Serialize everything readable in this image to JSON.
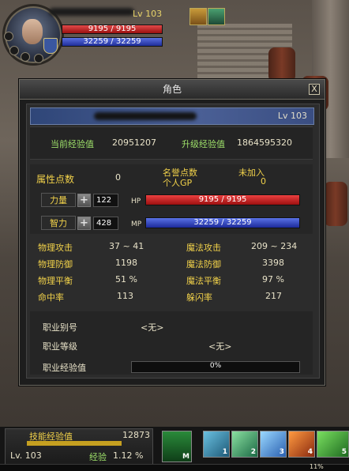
{
  "top": {
    "level": "Lv 103",
    "hp": "9195 / 9195",
    "mp": "32259 / 32259"
  },
  "window": {
    "title": "角色",
    "close": "X",
    "name_level": "Lv 103",
    "exp": {
      "current_label": "当前经验值",
      "current_value": "20951207",
      "next_label": "升级经验值",
      "next_value": "1864595320"
    },
    "attr": {
      "points_label": "属性点数",
      "points_value": "0",
      "fame_label": "名誉点数",
      "fame_value": "未加入",
      "gp_label": "个人GP",
      "gp_value": "0",
      "str_label": "力量",
      "str_value": "122",
      "hp_tag": "HP",
      "hp_value": "9195 / 9195",
      "int_label": "智力",
      "int_value": "428",
      "mp_tag": "MP",
      "mp_value": "32259 / 32259"
    },
    "stats": {
      "phys_atk_label": "物理攻击",
      "phys_atk_value": "37 ~ 41",
      "mag_atk_label": "魔法攻击",
      "mag_atk_value": "209 ~ 234",
      "phys_def_label": "物理防御",
      "phys_def_value": "1198",
      "mag_def_label": "魔法防御",
      "mag_def_value": "3398",
      "phys_bal_label": "物理平衡",
      "phys_bal_value": "51 %",
      "mag_bal_label": "魔法平衡",
      "mag_bal_value": "97 %",
      "hit_label": "命中率",
      "hit_value": "113",
      "dodge_label": "躲闪率",
      "dodge_value": "217"
    },
    "job": {
      "title_label": "职业别号",
      "title_value": "<无>",
      "grade_label": "职业等级",
      "grade_value": "<无>",
      "exp_label": "职业经验值",
      "exp_value": "0%",
      "exp_fraction": 0
    }
  },
  "hud": {
    "skill_exp_label": "技能经验值",
    "skill_exp_value": "12873",
    "level": "Lv. 103",
    "exp_label": "经验",
    "exp_value": "1.12 %",
    "skill_slot_key": "M",
    "slots": [
      "1",
      "2",
      "3",
      "4",
      "5"
    ],
    "bottom_percent": "11%"
  },
  "colors": {
    "hp": "#d42a2a",
    "mp": "#2f44c8",
    "label_green": "#9ee06a",
    "label_yellow": "#f2d24a"
  }
}
